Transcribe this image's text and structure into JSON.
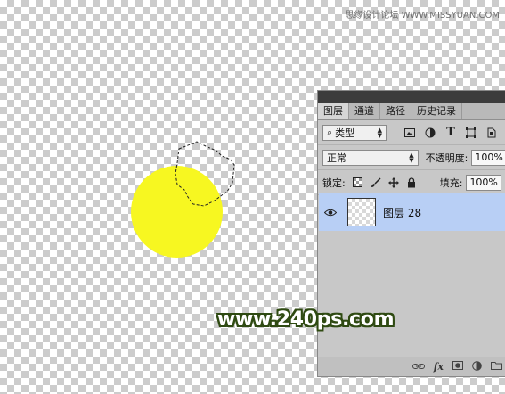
{
  "watermark": {
    "top": "思缘设计论坛 WWW.MISSYUAN.COM",
    "main": "www.240ps.com"
  },
  "colors": {
    "circle": "#f7f721",
    "selected_layer": "#b8cff5",
    "panel_bg": "#c8c8c8"
  },
  "panel": {
    "tabs": [
      "图层",
      "通道",
      "路径",
      "历史记录"
    ],
    "filter": {
      "select_label": "类型",
      "icons": [
        "image-filter-icon",
        "adjustment-filter-icon",
        "type-filter-icon",
        "shape-filter-icon",
        "smart-object-filter-icon"
      ],
      "type_glyph": "T"
    },
    "blend": {
      "mode": "正常",
      "opacity_label": "不透明度:",
      "opacity_value": "100%"
    },
    "lock": {
      "label": "锁定:",
      "fill_label": "填充:",
      "fill_value": "100%"
    },
    "layers": [
      {
        "name": "图层 28",
        "visible": true,
        "selected": true
      }
    ],
    "bottom_fx": "fx"
  }
}
